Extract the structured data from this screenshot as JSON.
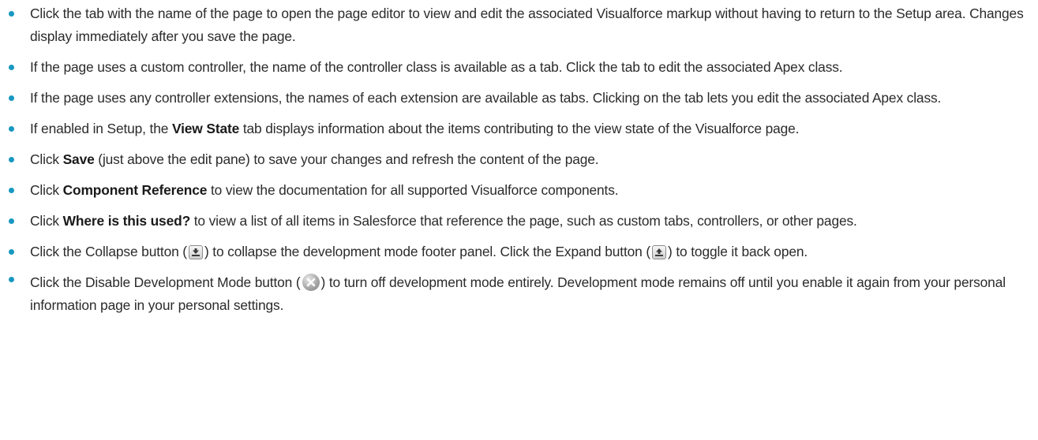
{
  "bullet_color": "#1798c1",
  "items": [
    {
      "text": "Click the tab with the name of the page to open the page editor to view and edit the associated Visualforce markup without having to return to the Setup area. Changes display immediately after you save the page."
    },
    {
      "text": "If the page uses a custom controller, the name of the controller class is available as a tab. Click the tab to edit the associated Apex class."
    },
    {
      "text": "If the page uses any controller extensions, the names of each extension are available as tabs. Clicking on the tab lets you edit the associated Apex class."
    },
    {
      "pre": "If enabled in Setup, the ",
      "bold": "View State",
      "post": " tab displays information about the items contributing to the view state of the Visualforce page."
    },
    {
      "pre": "Click ",
      "bold": "Save",
      "post": " (just above the edit pane) to save your changes and refresh the content of the page."
    },
    {
      "pre": "Click ",
      "bold": "Component Reference",
      "post": " to view the documentation for all supported Visualforce components."
    },
    {
      "pre": "Click ",
      "bold": "Where is this used?",
      "post": " to view a list of all items in Salesforce that reference the page, such as custom tabs, controllers, or other pages."
    },
    {
      "t1": "Click the Collapse button (",
      "t2": ") to collapse the development mode footer panel. Click the Expand button (",
      "t3": ") to toggle it back open.",
      "icon1": "collapse-icon",
      "icon2": "expand-icon"
    },
    {
      "t1": "Click the Disable Development Mode button (",
      "t2": ") to turn off development mode entirely. Development mode remains off until you enable it again from your personal information page in your personal settings.",
      "icon": "disable-development-mode-icon"
    }
  ]
}
